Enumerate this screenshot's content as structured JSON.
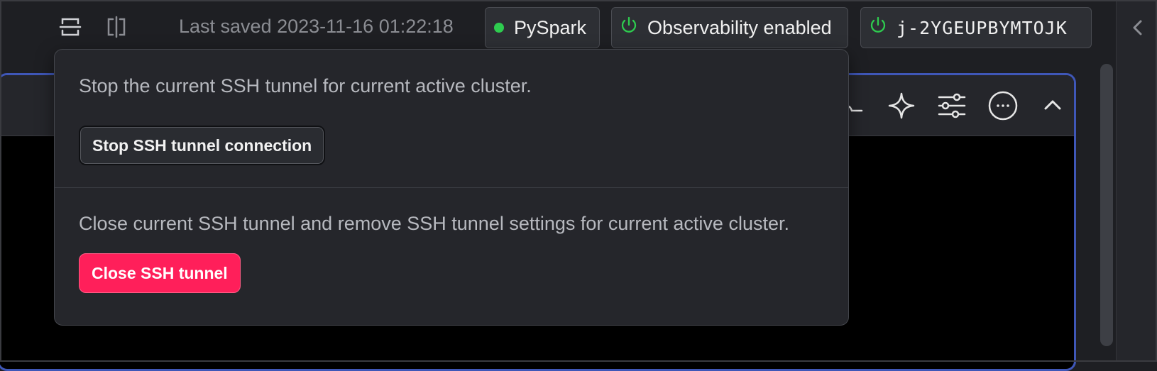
{
  "header": {
    "last_saved": "Last saved 2023-11-16 01:22:18",
    "kernel": "PySpark",
    "observability": "Observability enabled",
    "cluster_id": "j-2YGEUPBYMTOJK"
  },
  "colors": {
    "kernel_status": "#2ecc4f",
    "power_icon": "#2ecc4f",
    "cell_border_active": "#3f57b8",
    "danger_button": "#ff1f5a"
  },
  "icons": [
    "split-horizontal-icon",
    "split-vertical-icon",
    "power-icon",
    "chevron-left-icon",
    "sparkle-icon",
    "sliders-icon",
    "more-icon",
    "chevron-up-icon"
  ],
  "popover": {
    "stop_description": "Stop the current SSH tunnel for current active cluster.",
    "stop_button": "Stop SSH tunnel connection",
    "close_description": "Close current SSH tunnel and remove SSH tunnel settings for current active cluster.",
    "close_button": "Close SSH tunnel"
  }
}
